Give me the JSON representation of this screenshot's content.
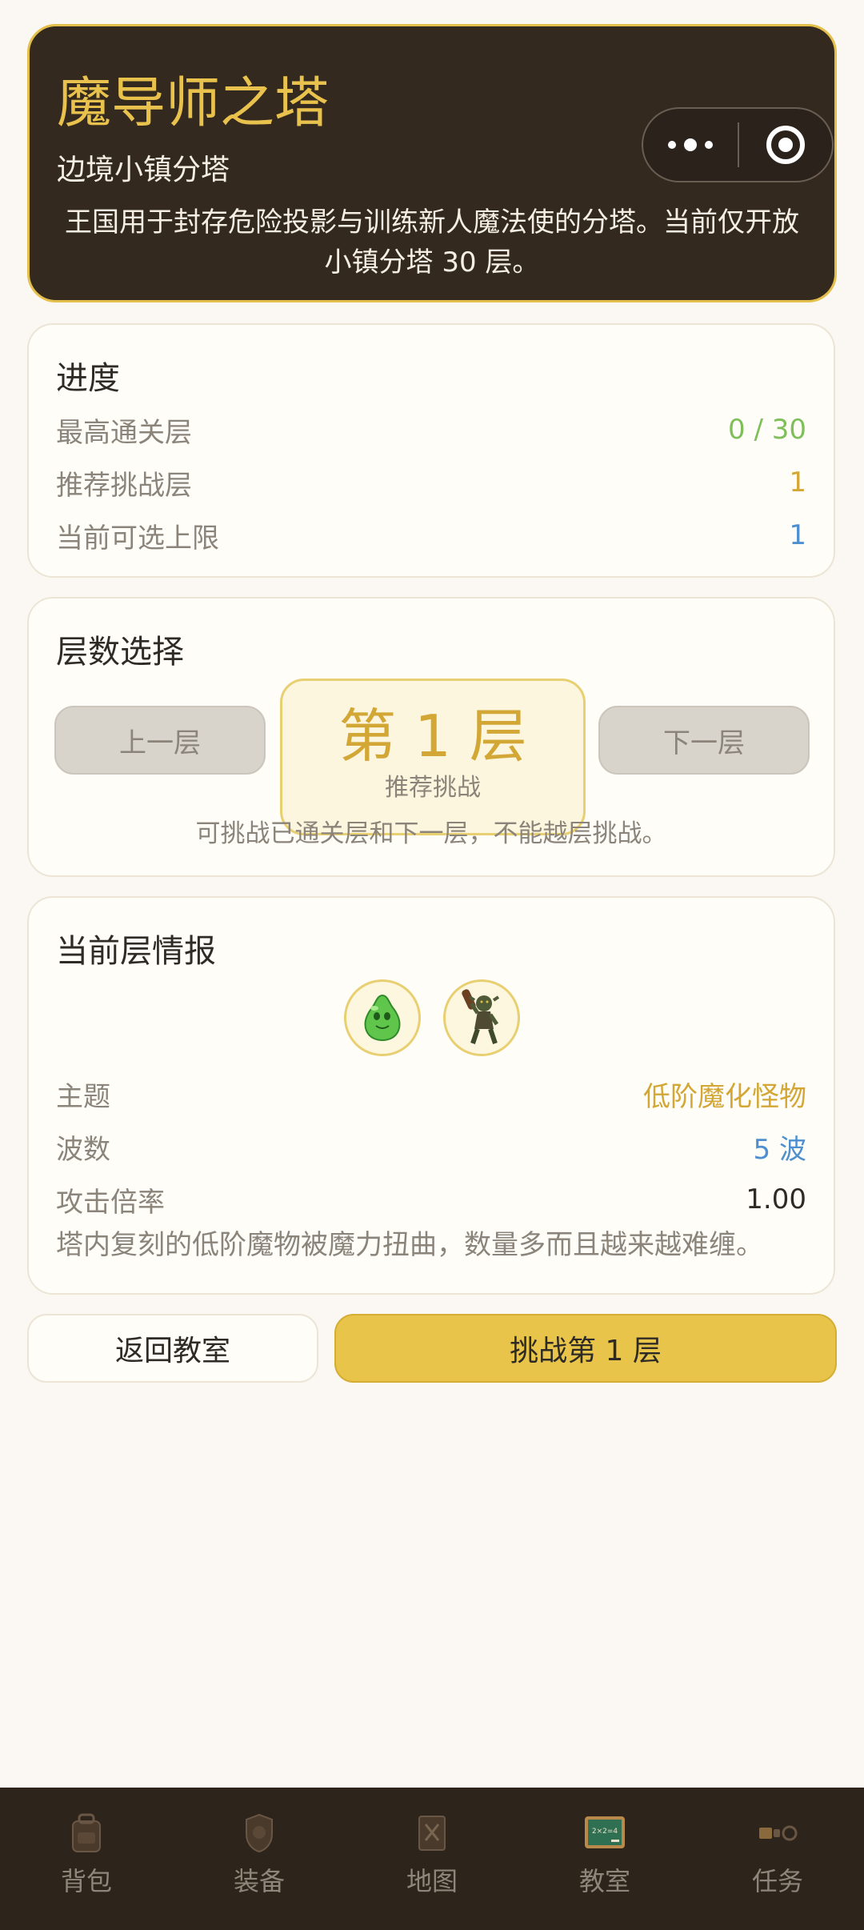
{
  "header": {
    "title": "魔导师之塔",
    "subtitle": "边境小镇分塔",
    "description": "王国用于封存危险投影与训练新人魔法使的分塔。当前仅开放小镇分塔 30 层。"
  },
  "capsule": {
    "more_icon": "more-dots-icon",
    "close_icon": "target-circle-icon"
  },
  "progress": {
    "title": "进度",
    "rows": [
      {
        "label": "最高通关层",
        "value": "0 / 30",
        "color": "#7fbf5a"
      },
      {
        "label": "推荐挑战层",
        "value": "1",
        "color": "#d3a735"
      },
      {
        "label": "当前可选上限",
        "value": "1",
        "color": "#4d8fcf"
      }
    ]
  },
  "floor_select": {
    "title": "层数选择",
    "prev_label": "上一层",
    "next_label": "下一层",
    "floor_label": "第 1 层",
    "floor_tag": "推荐挑战",
    "hint": "可挑战已通关层和下一层，不能越层挑战。"
  },
  "floor_info": {
    "title": "当前层情报",
    "monsters": [
      "green-slime-icon",
      "goblin-club-icon"
    ],
    "rows": [
      {
        "label": "主题",
        "value": "低阶魔化怪物",
        "color": "#d3a735"
      },
      {
        "label": "波数",
        "value": "5 波",
        "color": "#4d8fcf"
      },
      {
        "label": "攻击倍率",
        "value": "1.00",
        "color": "#2e2a25"
      }
    ],
    "description": "塔内复刻的低阶魔物被魔力扭曲，数量多而且越来越难缠。"
  },
  "actions": {
    "back_label": "返回教室",
    "challenge_label": "挑战第 1 层"
  },
  "tabbar": {
    "items": [
      {
        "label": "背包",
        "icon": "backpack-icon"
      },
      {
        "label": "装备",
        "icon": "equipment-icon"
      },
      {
        "label": "地图",
        "icon": "map-icon"
      },
      {
        "label": "教室",
        "icon": "classroom-board-icon"
      },
      {
        "label": "任务",
        "icon": "task-icon"
      }
    ],
    "active_index": 3
  }
}
